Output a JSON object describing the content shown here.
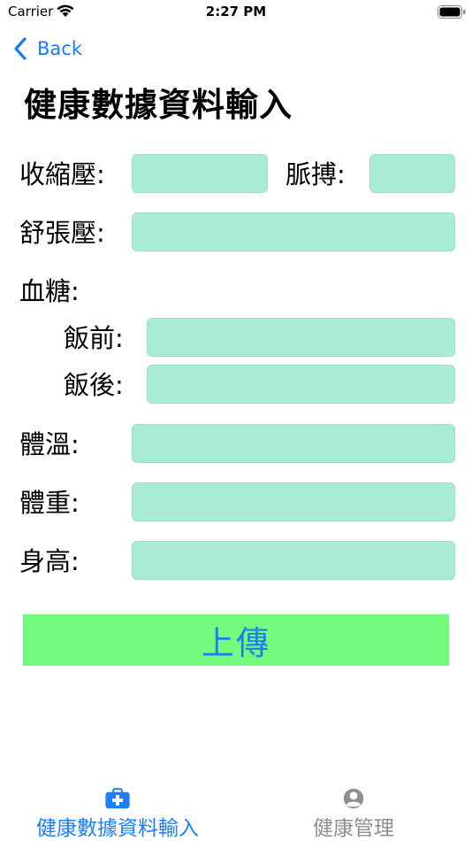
{
  "status_bar": {
    "carrier": "Carrier",
    "time": "2:27 PM"
  },
  "nav": {
    "back_label": "Back",
    "title": "健康數據資料輸入"
  },
  "form": {
    "systolic_label": "收縮壓:",
    "pulse_label": "脈搏:",
    "diastolic_label": "舒張壓:",
    "blood_sugar_label": "血糖:",
    "before_meal_label": "飯前:",
    "after_meal_label": "飯後:",
    "temperature_label": "體溫:",
    "weight_label": "體重:",
    "height_label": "身高:",
    "systolic_value": "",
    "pulse_value": "",
    "diastolic_value": "",
    "before_meal_value": "",
    "after_meal_value": "",
    "temperature_value": "",
    "weight_value": "",
    "height_value": ""
  },
  "upload_label": "上傳",
  "tabs": [
    {
      "label": "健康數據資料輸入",
      "icon": "medical-kit-icon",
      "selected": true
    },
    {
      "label": "健康管理",
      "icon": "person-circle-icon",
      "selected": false
    }
  ],
  "colors": {
    "accent": "#1a7ff5",
    "field_bg": "#a8ecd8",
    "button_bg": "#72fa7c",
    "tab_inactive": "#8e8e93"
  }
}
